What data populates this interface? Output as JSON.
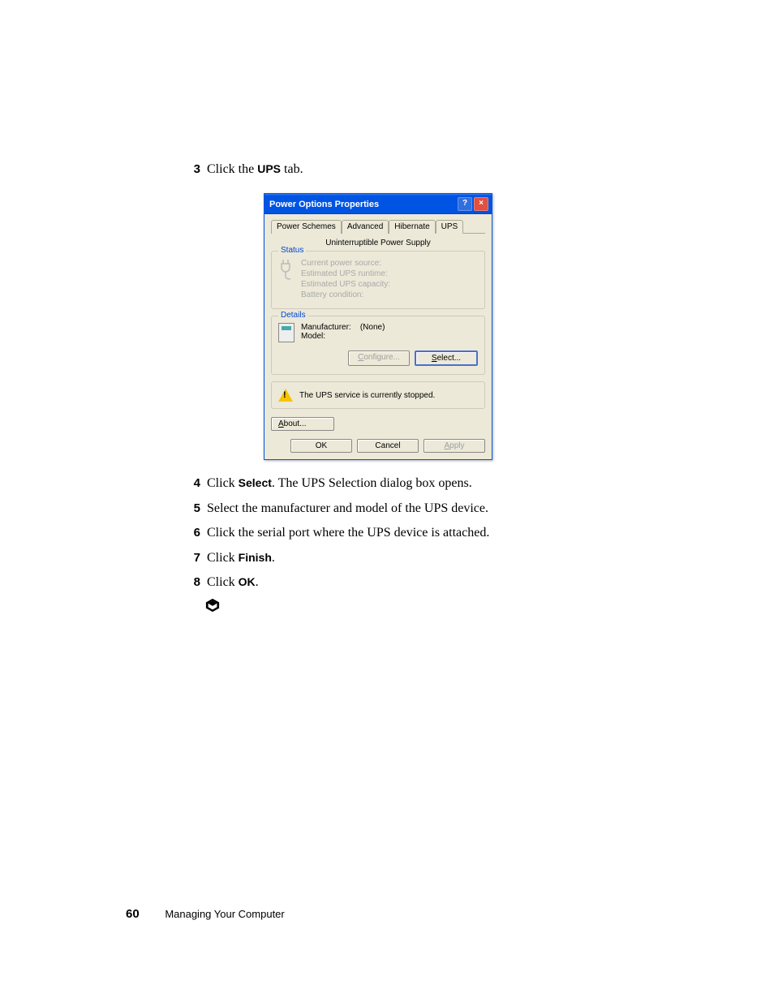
{
  "steps": {
    "s3": {
      "num": "3",
      "pre": "Click the ",
      "bold": "UPS",
      "post": " tab."
    },
    "s4": {
      "num": "4",
      "pre": "Click ",
      "bold": "Select",
      "post": ". The UPS Selection dialog box opens."
    },
    "s5": {
      "num": "5",
      "text": "Select the manufacturer and model of the UPS device."
    },
    "s6": {
      "num": "6",
      "text": "Click the serial port where the UPS device is attached."
    },
    "s7": {
      "num": "7",
      "pre": "Click ",
      "bold": "Finish",
      "post": "."
    },
    "s8": {
      "num": "8",
      "pre": "Click ",
      "bold": "OK",
      "post": "."
    }
  },
  "dialog": {
    "title": "Power Options Properties",
    "tabs": {
      "power_schemes": "Power Schemes",
      "advanced": "Advanced",
      "hibernate": "Hibernate",
      "ups": "UPS"
    },
    "heading": "Uninterruptible Power Supply",
    "status": {
      "label": "Status",
      "lines": {
        "l1": "Current power source:",
        "l2": "Estimated UPS runtime:",
        "l3": "Estimated UPS capacity:",
        "l4": "Battery condition:"
      }
    },
    "details": {
      "label": "Details",
      "manufacturer_label": "Manufacturer:",
      "manufacturer_value": "(None)",
      "model_label": "Model:",
      "buttons": {
        "configure": "Configure...",
        "select": "Select..."
      }
    },
    "warning": "The UPS service is currently stopped.",
    "about": "About...",
    "footer": {
      "ok": "OK",
      "cancel": "Cancel",
      "apply": "Apply"
    }
  },
  "footer": {
    "page_number": "60",
    "section": "Managing Your Computer"
  }
}
